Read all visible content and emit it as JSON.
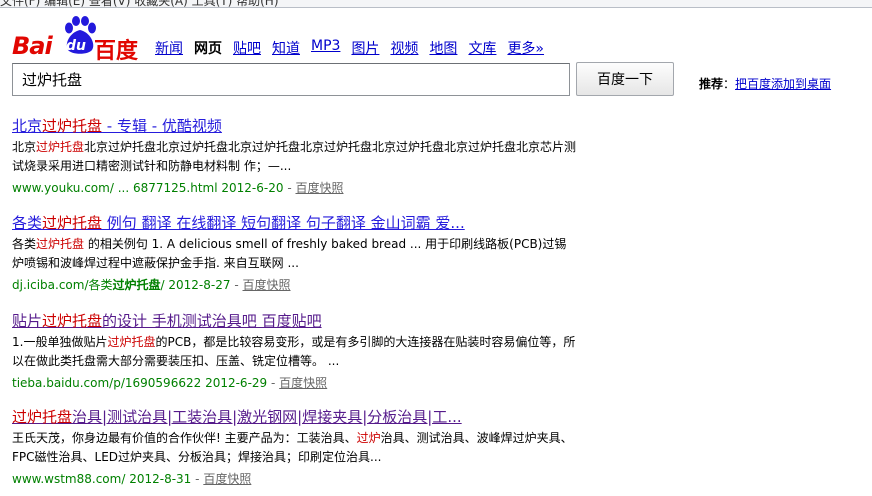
{
  "browser": {
    "top_text": "文件(F)   编辑(E)   查看(V)   收藏夹(A)   工具(T)   帮助(H)"
  },
  "logo": {
    "latin": "Bai",
    "du": "du",
    "chinese": "百度",
    "brand_color": "#e10601",
    "paw_color": "#2319dc"
  },
  "nav": {
    "items": [
      {
        "label": "新闻",
        "active": false
      },
      {
        "label": "网页",
        "active": true
      },
      {
        "label": "贴吧",
        "active": false
      },
      {
        "label": "知道",
        "active": false
      },
      {
        "label": "MP3",
        "active": false
      },
      {
        "label": "图片",
        "active": false
      },
      {
        "label": "视频",
        "active": false
      },
      {
        "label": "地图",
        "active": false
      },
      {
        "label": "文库",
        "active": false
      },
      {
        "label": "更多»",
        "active": false
      }
    ]
  },
  "search": {
    "query": "过炉托盘",
    "button_label": "百度一下"
  },
  "recommend": {
    "label": "推荐",
    "colon": "：",
    "link": "把百度添加到桌面"
  },
  "results": [
    {
      "title_parts": [
        "北京",
        "过炉托盘",
        " - 专辑  - 优酷视频"
      ],
      "abstract_parts": [
        "北京",
        "过炉托盘",
        "北京过炉托盘北京过炉托盘北京过炉托盘北京过炉托盘北京过炉托盘北京过炉托盘北京芯片测试烧录采用进口精密测试针和防静电材料制 作；—..."
      ],
      "url": "www.youku.com/ ... 6877125.html",
      "url_bold": "",
      "url_tail": "",
      "date": "2012-6-20",
      "cache": "百度快照",
      "visited": false
    },
    {
      "title_parts": [
        "各类",
        "过炉托盘",
        " 例句  翻译  在线翻译  短句翻译  句子翻译  金山词霸  爱..."
      ],
      "abstract_parts": [
        "各类",
        "过炉托盘",
        " 的相关例句  1. A delicious smell of freshly baked bread ... 用于印刷线路板(PCB)过锡炉喷锡和波峰焊过程中遮蔽保护金手指. 来自互联网  ..."
      ],
      "url": "dj.iciba.com/各类",
      "url_bold": "过炉托盘",
      "url_tail": "/",
      "date": "2012-8-27",
      "cache": "百度快照",
      "visited": false
    },
    {
      "title_parts": [
        "贴片",
        "过炉托盘",
        "的设计  手机测试治具吧  百度贴吧"
      ],
      "abstract_parts": [
        "1.一般单独做贴片",
        "过炉托盘",
        "的PCB，都是比较容易变形，或是有多引脚的大连接器在贴装时容易偏位等，所以在做此类托盘需大部分需要装压扣、压盖、铣定位槽等。 ..."
      ],
      "url": "tieba.baidu.com/p/1690596622",
      "url_bold": "",
      "url_tail": "",
      "date": "2012-6-29",
      "cache": "百度快照",
      "visited": true
    },
    {
      "title_parts": [
        "",
        "过炉托盘",
        "治具|测试治具|工装治具|激光钢网|焊接夹具|分板治具|工..."
      ],
      "abstract_parts": [
        "王氏天茂，你身边最有价值的合作伙伴! 主要产品为：工装治具、",
        "过炉",
        "治具、测试治具、波峰焊过炉夹具、FPC磁性治具、LED过炉夹具、分板治具；焊接治具；印刷定位治具..."
      ],
      "url": "www.wstm88.com/",
      "url_bold": "",
      "url_tail": "",
      "date": "2012-8-31",
      "cache": "百度快照",
      "visited": true
    }
  ],
  "colors": {
    "link": "#261cdc",
    "visited": "#551a8b",
    "highlight": "#cc0000",
    "url": "#008000"
  }
}
